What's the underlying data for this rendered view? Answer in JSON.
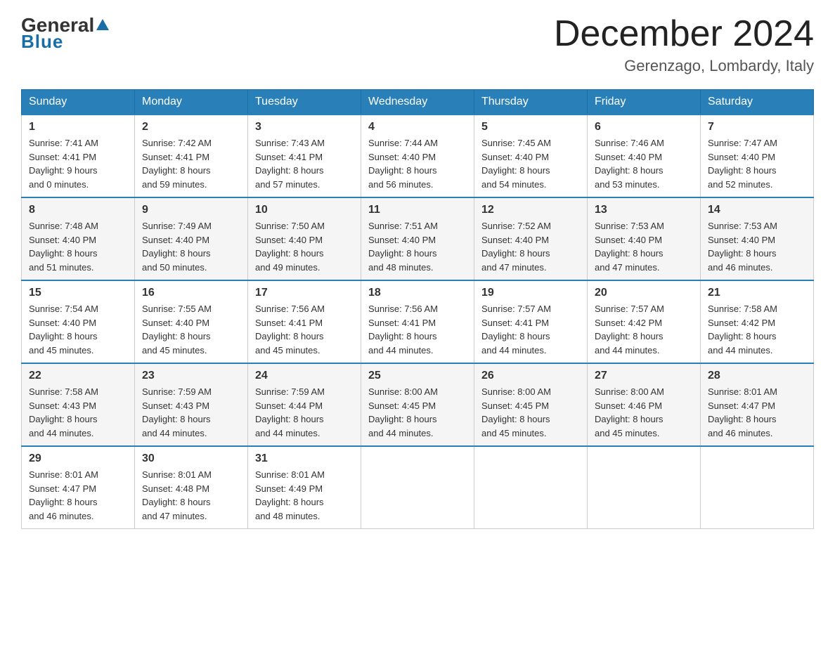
{
  "logo": {
    "general": "General",
    "blue": "Blue"
  },
  "title": {
    "month": "December 2024",
    "location": "Gerenzago, Lombardy, Italy"
  },
  "headers": [
    "Sunday",
    "Monday",
    "Tuesday",
    "Wednesday",
    "Thursday",
    "Friday",
    "Saturday"
  ],
  "weeks": [
    [
      {
        "day": "1",
        "sunrise": "7:41 AM",
        "sunset": "4:41 PM",
        "daylight": "9 hours and 0 minutes."
      },
      {
        "day": "2",
        "sunrise": "7:42 AM",
        "sunset": "4:41 PM",
        "daylight": "8 hours and 59 minutes."
      },
      {
        "day": "3",
        "sunrise": "7:43 AM",
        "sunset": "4:41 PM",
        "daylight": "8 hours and 57 minutes."
      },
      {
        "day": "4",
        "sunrise": "7:44 AM",
        "sunset": "4:40 PM",
        "daylight": "8 hours and 56 minutes."
      },
      {
        "day": "5",
        "sunrise": "7:45 AM",
        "sunset": "4:40 PM",
        "daylight": "8 hours and 54 minutes."
      },
      {
        "day": "6",
        "sunrise": "7:46 AM",
        "sunset": "4:40 PM",
        "daylight": "8 hours and 53 minutes."
      },
      {
        "day": "7",
        "sunrise": "7:47 AM",
        "sunset": "4:40 PM",
        "daylight": "8 hours and 52 minutes."
      }
    ],
    [
      {
        "day": "8",
        "sunrise": "7:48 AM",
        "sunset": "4:40 PM",
        "daylight": "8 hours and 51 minutes."
      },
      {
        "day": "9",
        "sunrise": "7:49 AM",
        "sunset": "4:40 PM",
        "daylight": "8 hours and 50 minutes."
      },
      {
        "day": "10",
        "sunrise": "7:50 AM",
        "sunset": "4:40 PM",
        "daylight": "8 hours and 49 minutes."
      },
      {
        "day": "11",
        "sunrise": "7:51 AM",
        "sunset": "4:40 PM",
        "daylight": "8 hours and 48 minutes."
      },
      {
        "day": "12",
        "sunrise": "7:52 AM",
        "sunset": "4:40 PM",
        "daylight": "8 hours and 47 minutes."
      },
      {
        "day": "13",
        "sunrise": "7:53 AM",
        "sunset": "4:40 PM",
        "daylight": "8 hours and 47 minutes."
      },
      {
        "day": "14",
        "sunrise": "7:53 AM",
        "sunset": "4:40 PM",
        "daylight": "8 hours and 46 minutes."
      }
    ],
    [
      {
        "day": "15",
        "sunrise": "7:54 AM",
        "sunset": "4:40 PM",
        "daylight": "8 hours and 45 minutes."
      },
      {
        "day": "16",
        "sunrise": "7:55 AM",
        "sunset": "4:40 PM",
        "daylight": "8 hours and 45 minutes."
      },
      {
        "day": "17",
        "sunrise": "7:56 AM",
        "sunset": "4:41 PM",
        "daylight": "8 hours and 45 minutes."
      },
      {
        "day": "18",
        "sunrise": "7:56 AM",
        "sunset": "4:41 PM",
        "daylight": "8 hours and 44 minutes."
      },
      {
        "day": "19",
        "sunrise": "7:57 AM",
        "sunset": "4:41 PM",
        "daylight": "8 hours and 44 minutes."
      },
      {
        "day": "20",
        "sunrise": "7:57 AM",
        "sunset": "4:42 PM",
        "daylight": "8 hours and 44 minutes."
      },
      {
        "day": "21",
        "sunrise": "7:58 AM",
        "sunset": "4:42 PM",
        "daylight": "8 hours and 44 minutes."
      }
    ],
    [
      {
        "day": "22",
        "sunrise": "7:58 AM",
        "sunset": "4:43 PM",
        "daylight": "8 hours and 44 minutes."
      },
      {
        "day": "23",
        "sunrise": "7:59 AM",
        "sunset": "4:43 PM",
        "daylight": "8 hours and 44 minutes."
      },
      {
        "day": "24",
        "sunrise": "7:59 AM",
        "sunset": "4:44 PM",
        "daylight": "8 hours and 44 minutes."
      },
      {
        "day": "25",
        "sunrise": "8:00 AM",
        "sunset": "4:45 PM",
        "daylight": "8 hours and 44 minutes."
      },
      {
        "day": "26",
        "sunrise": "8:00 AM",
        "sunset": "4:45 PM",
        "daylight": "8 hours and 45 minutes."
      },
      {
        "day": "27",
        "sunrise": "8:00 AM",
        "sunset": "4:46 PM",
        "daylight": "8 hours and 45 minutes."
      },
      {
        "day": "28",
        "sunrise": "8:01 AM",
        "sunset": "4:47 PM",
        "daylight": "8 hours and 46 minutes."
      }
    ],
    [
      {
        "day": "29",
        "sunrise": "8:01 AM",
        "sunset": "4:47 PM",
        "daylight": "8 hours and 46 minutes."
      },
      {
        "day": "30",
        "sunrise": "8:01 AM",
        "sunset": "4:48 PM",
        "daylight": "8 hours and 47 minutes."
      },
      {
        "day": "31",
        "sunrise": "8:01 AM",
        "sunset": "4:49 PM",
        "daylight": "8 hours and 48 minutes."
      },
      null,
      null,
      null,
      null
    ]
  ],
  "labels": {
    "sunrise": "Sunrise:",
    "sunset": "Sunset:",
    "daylight": "Daylight:"
  }
}
